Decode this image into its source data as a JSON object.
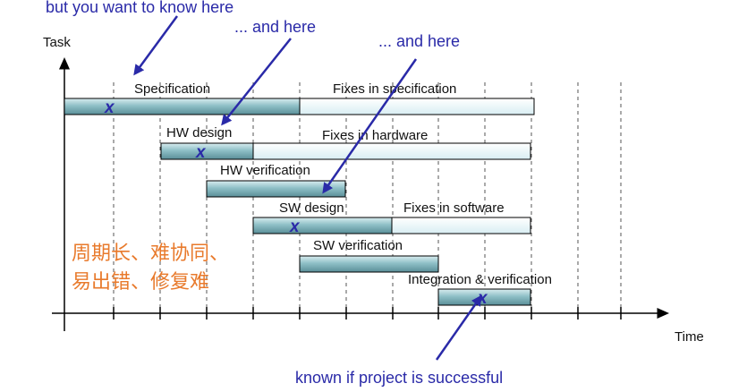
{
  "annotations": {
    "top_left": "but you want to know here",
    "top_mid": "... and here",
    "top_right": "... and here",
    "bottom": "known if project is successful"
  },
  "axes": {
    "y_label": "Task",
    "x_label": "Time"
  },
  "tasks": [
    {
      "label": "Specification",
      "fix_label": "Fixes in specification"
    },
    {
      "label": "HW design",
      "fix_label": "Fixes in hardware"
    },
    {
      "label": "HW verification"
    },
    {
      "label": "SW design",
      "fix_label": "Fixes in software"
    },
    {
      "label": "SW verification"
    },
    {
      "label": "Integration & verification"
    }
  ],
  "side_note": {
    "line1": "周期长、难协同、",
    "line2": "易出错、修复难"
  },
  "colors": {
    "arrow": "#2a2aa8",
    "note": "#e87a2c",
    "bar_light": "#eaf7fa",
    "bar_dark": "#7fb2ba"
  }
}
